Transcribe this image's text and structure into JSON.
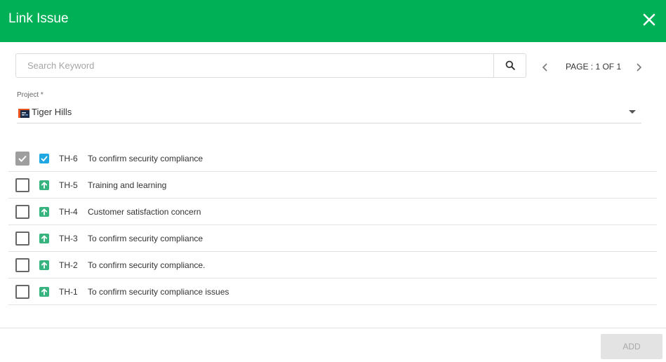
{
  "dialog": {
    "title": "Link Issue",
    "close_icon": "close-icon",
    "header_color": "#00b057"
  },
  "search": {
    "placeholder": "Search Keyword",
    "value": "",
    "icon": "search-icon"
  },
  "pagination": {
    "text": "PAGE : 1 OF 1",
    "prev_icon": "chevron-left-icon",
    "next_icon": "chevron-right-icon"
  },
  "project": {
    "label": "Project *",
    "selected": "Tiger Hills",
    "logo_icon": "project-logo-icon",
    "dropdown_icon": "caret-down-icon"
  },
  "issues": [
    {
      "key": "TH-6",
      "summary": "To confirm security compliance",
      "checked": true,
      "type_icon": "subtask-checkbox-icon",
      "type_color": "#1ea7e1"
    },
    {
      "key": "TH-5",
      "summary": "Training and learning",
      "checked": false,
      "type_icon": "improvement-arrow-up-icon",
      "type_color": "#36b37e"
    },
    {
      "key": "TH-4",
      "summary": "Customer satisfaction concern",
      "checked": false,
      "type_icon": "improvement-arrow-up-icon",
      "type_color": "#36b37e"
    },
    {
      "key": "TH-3",
      "summary": "To confirm security compliance",
      "checked": false,
      "type_icon": "improvement-arrow-up-icon",
      "type_color": "#36b37e"
    },
    {
      "key": "TH-2",
      "summary": "To confirm security compliance.",
      "checked": false,
      "type_icon": "improvement-arrow-up-icon",
      "type_color": "#36b37e"
    },
    {
      "key": "TH-1",
      "summary": "To confirm security compliance issues",
      "checked": false,
      "type_icon": "improvement-arrow-up-icon",
      "type_color": "#36b37e"
    }
  ],
  "footer": {
    "add_label": "ADD",
    "add_enabled": false
  }
}
